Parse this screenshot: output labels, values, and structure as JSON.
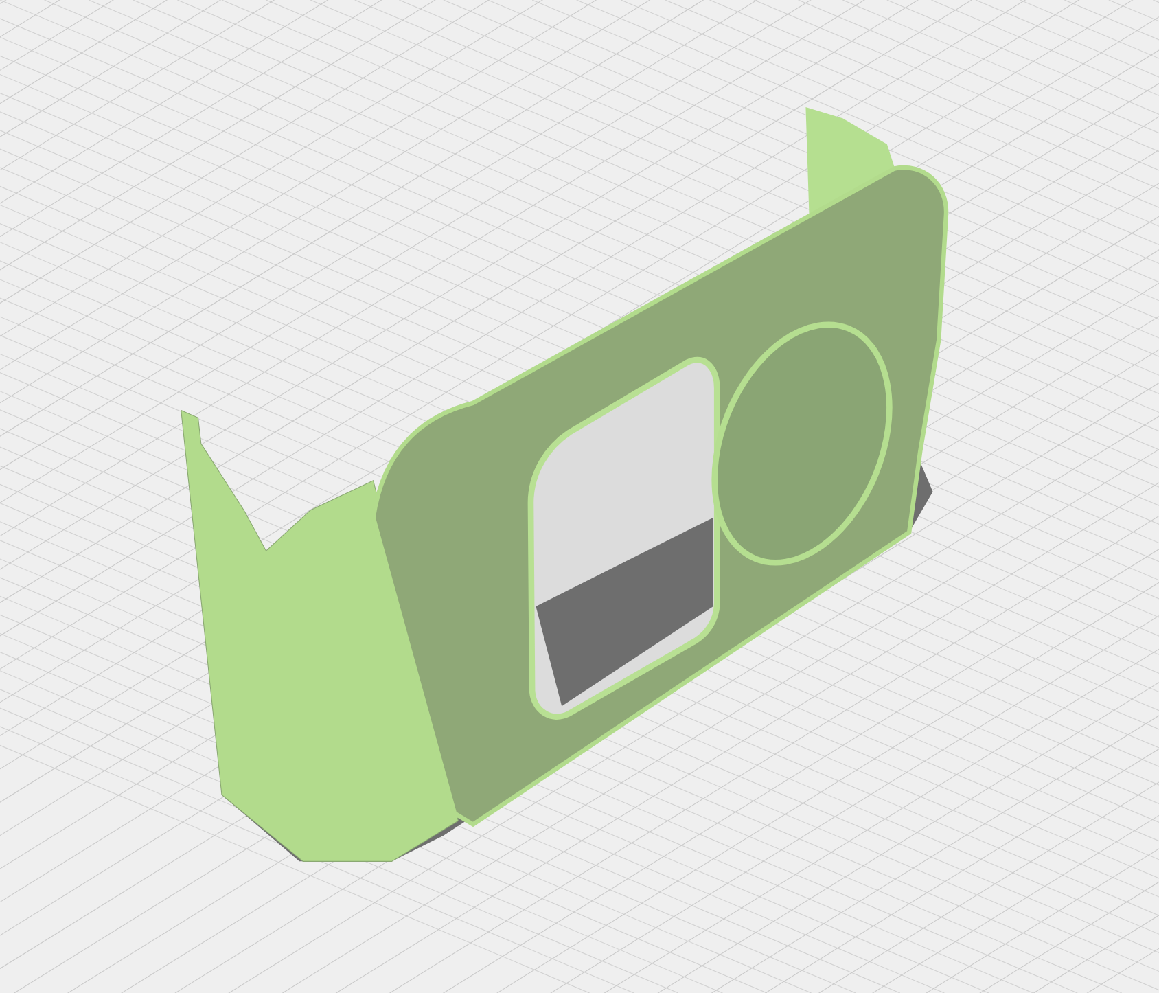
{
  "viewport": {
    "grid_visible": true,
    "shadow_visible": true
  }
}
